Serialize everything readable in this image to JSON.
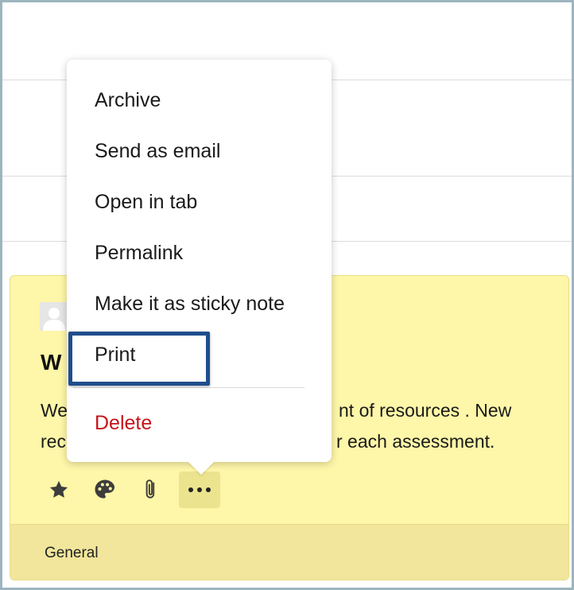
{
  "menu": {
    "items": [
      {
        "label": "Archive"
      },
      {
        "label": "Send as email"
      },
      {
        "label": "Open in tab"
      },
      {
        "label": "Permalink"
      },
      {
        "label": "Make it as sticky note"
      },
      {
        "label": "Print"
      }
    ],
    "delete_label": "Delete",
    "delete_color": "#c6141a"
  },
  "note": {
    "title_visible": "W",
    "body_line1_left": "We",
    "body_line1_right": "nt of resources . New",
    "body_line2_left": "rec",
    "body_line2_right": "r each assessment.",
    "background_color": "#fef6a8",
    "actions": {
      "star_icon": "star-icon",
      "palette_icon": "palette-icon",
      "attach_icon": "paperclip-icon",
      "more_icon": "more-horizontal-icon"
    },
    "footer_label": "General"
  },
  "highlight_color": "#1f4e8c"
}
